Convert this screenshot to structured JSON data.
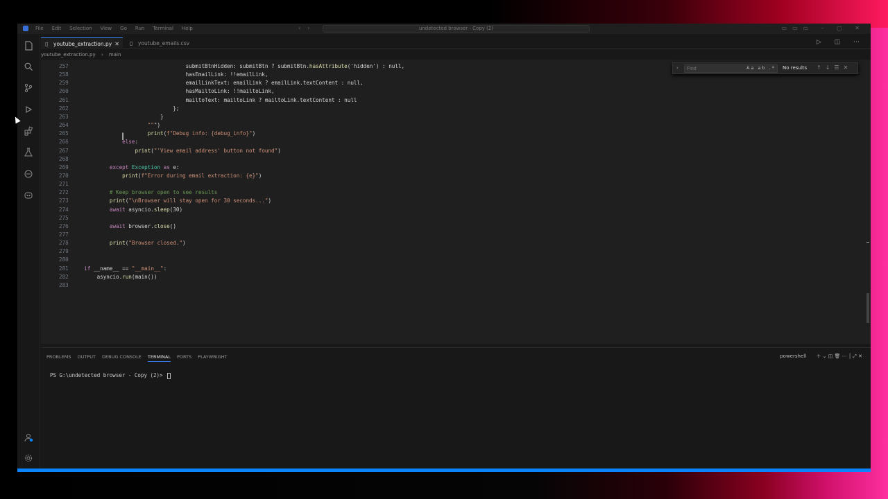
{
  "window_title": "undetected browser - Copy (2)",
  "menu": [
    "File",
    "Edit",
    "Selection",
    "View",
    "Go",
    "Run",
    "Terminal",
    "Help"
  ],
  "tabs": [
    {
      "label": "youtube_extraction.py",
      "active": true
    },
    {
      "label": "youtube_emails.csv",
      "active": false
    }
  ],
  "breadcrumbs": [
    "youtube_extraction.py",
    "main"
  ],
  "find": {
    "placeholder": "Find",
    "options": "Aa ab .*",
    "result": "No results"
  },
  "code_lines": [
    {
      "n": "257",
      "text": "                                    submitBtnHidden: submitBtn ? submitBtn.hasAttribute('hidden') : null,"
    },
    {
      "n": "258",
      "text": "                                    hasEmailLink: !!emailLink,"
    },
    {
      "n": "259",
      "text": "                                    emailLinkText: emailLink ? emailLink.textContent : null,"
    },
    {
      "n": "260",
      "text": "                                    hasMailtoLink: !!mailtoLink,"
    },
    {
      "n": "261",
      "text": "                                    mailtoText: mailtoLink ? mailtoLink.textContent : null"
    },
    {
      "n": "262",
      "text": "                                };"
    },
    {
      "n": "263",
      "text": "                            }"
    },
    {
      "n": "264",
      "text": "                        \"\"\")"
    },
    {
      "n": "265",
      "text": "                        print(f\"Debug info: {debug_info}\")"
    },
    {
      "n": "266",
      "text": "                else:"
    },
    {
      "n": "267",
      "text": "                    print(\"'View email address' button not found\")"
    },
    {
      "n": "268",
      "text": ""
    },
    {
      "n": "269",
      "text": "            except Exception as e:"
    },
    {
      "n": "270",
      "text": "                print(f\"Error during email extraction: {e}\")"
    },
    {
      "n": "271",
      "text": ""
    },
    {
      "n": "272",
      "text": "            # Keep browser open to see results"
    },
    {
      "n": "273",
      "text": "            print(\"\\nBrowser will stay open for 30 seconds...\")"
    },
    {
      "n": "274",
      "text": "            await asyncio.sleep(30)"
    },
    {
      "n": "275",
      "text": ""
    },
    {
      "n": "276",
      "text": "            await browser.close()"
    },
    {
      "n": "277",
      "text": ""
    },
    {
      "n": "278",
      "text": "            print(\"Browser closed.\")"
    },
    {
      "n": "279",
      "text": ""
    },
    {
      "n": "280",
      "text": ""
    },
    {
      "n": "281",
      "text": "    if __name__ == \"__main__\":"
    },
    {
      "n": "282",
      "text": "        asyncio.run(main())"
    },
    {
      "n": "283",
      "text": ""
    }
  ],
  "panel": {
    "tabs": [
      "PROBLEMS",
      "OUTPUT",
      "DEBUG CONSOLE",
      "TERMINAL",
      "PORTS",
      "PLAYWRIGHT"
    ],
    "active_tab": "TERMINAL",
    "shell": "powershell",
    "prompt": "PS G:\\undetected browser - Copy (2)> "
  },
  "colors": {
    "accent": "#3b82f6",
    "status_bar": "#0a84ff",
    "editor_bg": "#1f1f1f"
  }
}
